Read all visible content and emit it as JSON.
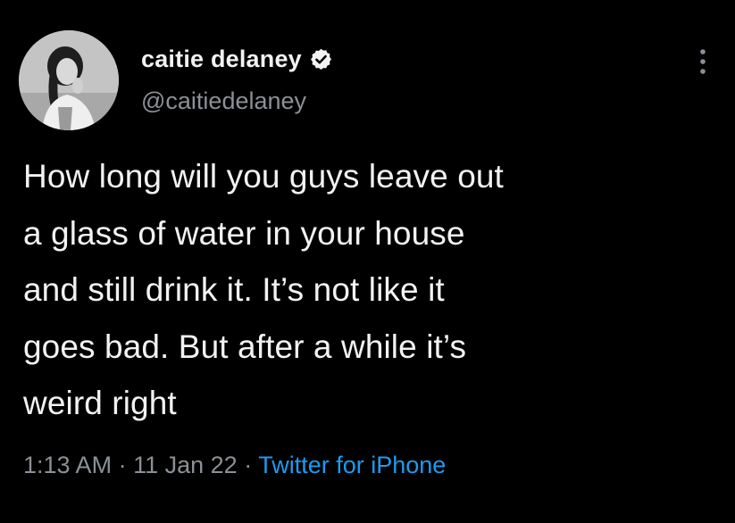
{
  "tweet": {
    "display_name": "caitie delaney",
    "handle": "@caitiedelaney",
    "verified": true,
    "text_lines": [
      "How long will you guys leave out",
      "a glass of water in your house",
      "and still drink it. It’s not like it",
      "goes bad. But after a while it’s",
      "weird right"
    ],
    "time": "1:13 AM",
    "separator": "·",
    "date": "11 Jan 22",
    "source": "Twitter for iPhone"
  },
  "icons": {
    "verified": "verified-badge-icon",
    "more": "more-options-icon"
  },
  "colors": {
    "background": "#000000",
    "text_primary": "#f2f2f2",
    "text_secondary": "#8b9096",
    "link": "#1d9bf0"
  }
}
